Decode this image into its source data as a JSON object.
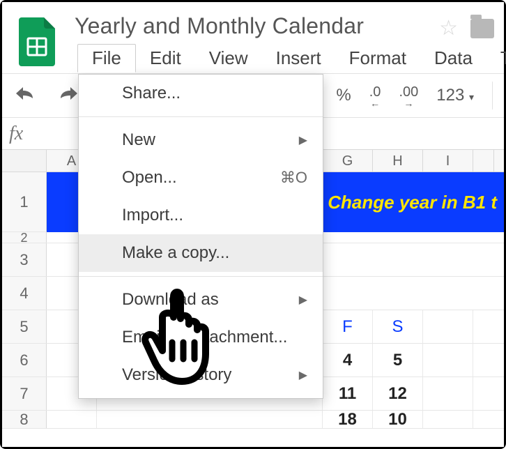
{
  "doc": {
    "title": "Yearly and Monthly Calendar"
  },
  "menubar": {
    "file": "File",
    "edit": "Edit",
    "view": "View",
    "insert": "Insert",
    "format": "Format",
    "data": "Data",
    "tools": "To"
  },
  "toolbar": {
    "percent": "%",
    "dec0": ".0",
    "dec00": ".00",
    "numfmt": "123"
  },
  "formula": {
    "fx": "fx"
  },
  "columns": [
    "A",
    "G",
    "H",
    "I"
  ],
  "columns_partial_last": "",
  "rows": {
    "r1": "1",
    "r2": "2",
    "r3": "3",
    "r4": "4",
    "r5": "5",
    "r6": "6",
    "r7": "7",
    "r8": "8"
  },
  "banner": {
    "text": "Change year in B1 t"
  },
  "dayheaders": {
    "F": "F",
    "S": "S"
  },
  "calendar": {
    "r6": {
      "c1": "4",
      "c2": "5"
    },
    "r7": {
      "c1": "11",
      "c2": "12"
    },
    "r8": {
      "c1": "18",
      "c2": "10"
    }
  },
  "menu": {
    "share": "Share...",
    "new": "New",
    "open": "Open...",
    "open_shortcut": "⌘O",
    "import": "Import...",
    "makecopy": "Make a copy...",
    "download": "Download as",
    "email": "Email as attachment...",
    "version": "Version history"
  }
}
